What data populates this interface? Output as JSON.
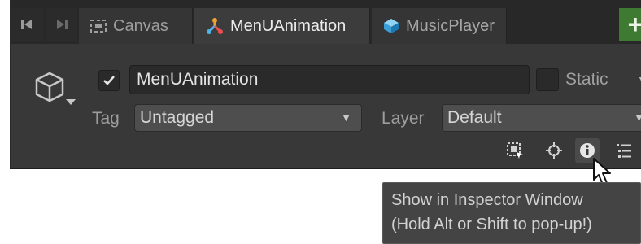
{
  "tabs": {
    "canvas_label": "Canvas",
    "menu_label": "MenUAnimation",
    "music_label": "MusicPlayer",
    "add_label": "+"
  },
  "header": {
    "object_name": "MenUAnimation",
    "active_checked": true,
    "static_label": "Static",
    "tag_label": "Tag",
    "tag_value": "Untagged",
    "layer_label": "Layer",
    "layer_value": "Default"
  },
  "tooltip": {
    "line1": "Show in Inspector Window",
    "line2": "(Hold Alt or Shift to pop-up!)"
  },
  "icons": {
    "back": "skip-back-icon",
    "forward": "skip-forward-icon",
    "canvas": "canvas-icon",
    "prefab_tree": "prefab-hierarchy-icon",
    "music": "prefab-cube-icon",
    "gameobject": "gameobject-cube-icon",
    "rect_select": "rect-select-icon",
    "pivot": "pivot-crosshair-icon",
    "info": "info-icon",
    "list": "list-icon",
    "cursor": "mouse-pointer-icon"
  },
  "colors": {
    "panel_bg": "#383838",
    "tab_bar_bg": "#282828",
    "active_tab_bg": "#3c3c3c",
    "add_button": "#3f7a33",
    "music_icon": "#4fb3e8",
    "tooltip_bg": "#444444"
  }
}
